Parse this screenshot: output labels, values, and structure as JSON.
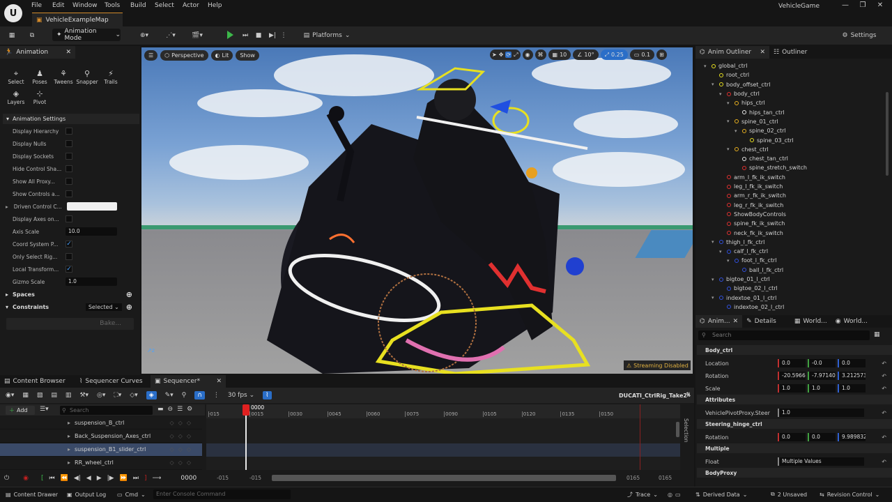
{
  "menu": [
    "File",
    "Edit",
    "Window",
    "Tools",
    "Build",
    "Select",
    "Actor",
    "Help"
  ],
  "map_tab": "VehicleExampleMap",
  "app_title": "VehicleGame",
  "toolbar": {
    "mode": "Animation Mode",
    "platforms": "Platforms",
    "settings": "Settings"
  },
  "animation_panel": {
    "tab": "Animation",
    "tools": [
      "Select",
      "Poses",
      "Tweens",
      "Snapper",
      "Trails",
      "Layers",
      "Pivot"
    ],
    "settings_header": "Animation Settings",
    "settings": [
      {
        "label": "Display Hierarchy",
        "type": "check",
        "value": false
      },
      {
        "label": "Display Nulls",
        "type": "check",
        "value": false
      },
      {
        "label": "Display Sockets",
        "type": "check",
        "value": false
      },
      {
        "label": "Hide Control Sha...",
        "type": "check",
        "value": false
      },
      {
        "label": "Show All Proxy...",
        "type": "check",
        "value": false
      },
      {
        "label": "Show Controls a...",
        "type": "check",
        "value": false
      },
      {
        "label": "Driven Control C...",
        "type": "color",
        "value": ""
      },
      {
        "label": "Display Axes on...",
        "type": "check",
        "value": false
      },
      {
        "label": "Axis Scale",
        "type": "num",
        "value": "10.0"
      },
      {
        "label": "Coord System P...",
        "type": "check",
        "value": true
      },
      {
        "label": "Only Select Rig...",
        "type": "check",
        "value": false
      },
      {
        "label": "Local Transform...",
        "type": "check",
        "value": true
      },
      {
        "label": "Gizmo Scale",
        "type": "num",
        "value": "1.0"
      }
    ],
    "spaces": "Spaces",
    "constraints": "Constraints",
    "constraints_value": "Selected",
    "bake": "Bake..."
  },
  "viewport": {
    "perspective": "Perspective",
    "lit": "Lit",
    "show": "Show",
    "grid": "10",
    "angle": "10°",
    "scale": "0.25",
    "camera": "0.1",
    "streaming": "Streaming Disabled"
  },
  "outliner": {
    "tabs": [
      "Anim Outliner",
      "Outliner"
    ],
    "items": [
      {
        "name": "global_ctrl",
        "depth": 0,
        "color": "#e8e020",
        "arrow": true
      },
      {
        "name": "root_ctrl",
        "depth": 1,
        "color": "#e8e020",
        "arrow": false
      },
      {
        "name": "body_offset_ctrl",
        "depth": 1,
        "color": "#e8e020",
        "arrow": true
      },
      {
        "name": "body_ctrl",
        "depth": 2,
        "color": "#e03030",
        "arrow": true
      },
      {
        "name": "hips_ctrl",
        "depth": 3,
        "color": "#e8b020",
        "arrow": true
      },
      {
        "name": "hips_tan_ctrl",
        "depth": 4,
        "color": "#e8e8e8",
        "arrow": false
      },
      {
        "name": "spine_01_ctrl",
        "depth": 3,
        "color": "#e8b020",
        "arrow": true
      },
      {
        "name": "spine_02_ctrl",
        "depth": 4,
        "color": "#e8b020",
        "arrow": true
      },
      {
        "name": "spine_03_ctrl",
        "depth": 5,
        "color": "#e8e020",
        "arrow": false
      },
      {
        "name": "chest_ctrl",
        "depth": 3,
        "color": "#e8b020",
        "arrow": true
      },
      {
        "name": "chest_tan_ctrl",
        "depth": 4,
        "color": "#e8e8e8",
        "arrow": false
      },
      {
        "name": "spine_stretch_switch",
        "depth": 4,
        "color": "#e03030",
        "arrow": false
      },
      {
        "name": "arm_l_fk_ik_switch",
        "depth": 2,
        "color": "#e03030",
        "arrow": false
      },
      {
        "name": "leg_l_fk_ik_switch",
        "depth": 2,
        "color": "#e03030",
        "arrow": false
      },
      {
        "name": "arm_r_fk_ik_switch",
        "depth": 2,
        "color": "#e03030",
        "arrow": false
      },
      {
        "name": "leg_r_fk_ik_switch",
        "depth": 2,
        "color": "#e03030",
        "arrow": false
      },
      {
        "name": "ShowBodyControls",
        "depth": 2,
        "color": "#e03030",
        "arrow": false
      },
      {
        "name": "spine_fk_ik_switch",
        "depth": 2,
        "color": "#e03030",
        "arrow": false
      },
      {
        "name": "neck_fk_ik_switch",
        "depth": 2,
        "color": "#e03030",
        "arrow": false
      },
      {
        "name": "thigh_l_fk_ctrl",
        "depth": 1,
        "color": "#3050e0",
        "arrow": true
      },
      {
        "name": "calf_l_fk_ctrl",
        "depth": 2,
        "color": "#3050e0",
        "arrow": true
      },
      {
        "name": "foot_l_fk_ctrl",
        "depth": 3,
        "color": "#3050e0",
        "arrow": true
      },
      {
        "name": "ball_l_fk_ctrl",
        "depth": 4,
        "color": "#3050e0",
        "arrow": false
      },
      {
        "name": "bigtoe_01_l_ctrl",
        "depth": 1,
        "color": "#3050e0",
        "arrow": true
      },
      {
        "name": "bigtoe_02_l_ctrl",
        "depth": 2,
        "color": "#3050e0",
        "arrow": false
      },
      {
        "name": "indextoe_01_l_ctrl",
        "depth": 1,
        "color": "#3050e0",
        "arrow": true
      },
      {
        "name": "indextoe_02_l_ctrl",
        "depth": 2,
        "color": "#3050e0",
        "arrow": false
      }
    ]
  },
  "details": {
    "tabs": [
      "Anim...",
      "Details",
      "World...",
      "World..."
    ],
    "search": "Search",
    "sections": [
      {
        "header": "Body_ctrl",
        "rows": [
          {
            "label": "Location",
            "values": [
              "0.0",
              "-0.0",
              "0.0"
            ]
          },
          {
            "label": "Rotation",
            "values": [
              "-20.5966",
              "-7.97140",
              "3.212573"
            ]
          },
          {
            "label": "Scale",
            "values": [
              "1.0",
              "1.0",
              "1.0"
            ]
          }
        ]
      },
      {
        "header": "Attributes",
        "rows": [
          {
            "label": "VehiclePivotProxy.Steer",
            "values": [
              "1.0"
            ]
          }
        ]
      },
      {
        "header": "Steering_hinge_ctrl",
        "rows": [
          {
            "label": "Rotation",
            "values": [
              "0.0",
              "0.0",
              "9.989832"
            ]
          }
        ]
      },
      {
        "header": "Multiple",
        "rows": [
          {
            "label": "Float",
            "values": [
              "Multiple Values"
            ]
          }
        ]
      },
      {
        "header": "BodyProxy",
        "rows": []
      }
    ]
  },
  "bottom": {
    "tabs": [
      "Content Browser",
      "Sequencer Curves",
      "Sequencer*"
    ],
    "fps": "30 fps",
    "sequence_name": "DUCATI_CtrlRig_Take2*",
    "add": "Add",
    "search": "Search",
    "tracks": [
      "suspension_B_ctrl",
      "Back_Suspension_Axes_ctrl",
      "suspension_B1_slider_ctrl",
      "RR_wheel_ctrl"
    ],
    "ruler_ticks": [
      "-015",
      "0015",
      "0030",
      "0045",
      "0060",
      "0075",
      "0090",
      "0105",
      "0120",
      "0135",
      "0150"
    ],
    "playhead_frame": "0000",
    "current_frame": "0000",
    "range_start": "-015",
    "range_start2": "-015",
    "range_end": "0165",
    "range_end2": "0165",
    "selection_label": "Selection"
  },
  "statusbar": {
    "content_drawer": "Content Drawer",
    "output_log": "Output Log",
    "cmd": "Cmd",
    "console_placeholder": "Enter Console Command",
    "trace": "Trace",
    "derived_data": "Derived Data",
    "unsaved": "2 Unsaved",
    "revision": "Revision Control"
  }
}
